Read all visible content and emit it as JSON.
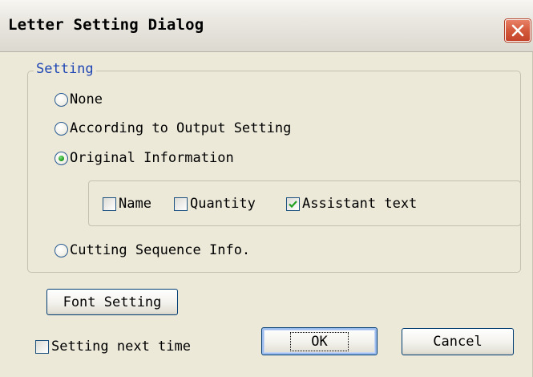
{
  "dialog": {
    "title": "Letter Setting Dialog"
  },
  "group": {
    "legend": "Setting"
  },
  "options": {
    "none": "None",
    "output": "According to Output Setting",
    "original": "Original Information",
    "cutting": "Cutting Sequence Info.",
    "selected": "Original Information"
  },
  "sub_options": {
    "name": {
      "label": "Name",
      "checked": false
    },
    "quantity": {
      "label": "Quantity",
      "checked": false
    },
    "assistant": {
      "label": "Assistant text",
      "checked": true
    }
  },
  "buttons": {
    "font_setting": "Font Setting",
    "ok": "OK",
    "cancel": "Cancel"
  },
  "footer": {
    "setting_next_time": {
      "label": "Setting next time",
      "checked": false
    }
  },
  "icons": {
    "close": "close-icon",
    "check": "check-icon"
  },
  "colors": {
    "window_bg": "#ece9d8",
    "legend_text": "#1f46b4",
    "close_button": "#d45a3c",
    "check_mark": "#21a121"
  }
}
